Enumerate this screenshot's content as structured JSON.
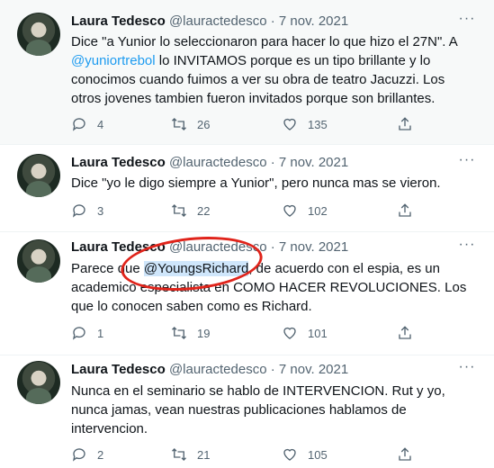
{
  "colors": {
    "accent": "#1d9bf0",
    "muted": "#536471",
    "annotation": "#e0241b"
  },
  "tweets": [
    {
      "name": "Laura Tedesco",
      "handle": "@lauractedesco",
      "separator": "·",
      "date": "7 nov. 2021",
      "text_before": "Dice \"a Yunior lo seleccionaron para hacer lo que hizo el 27N\". A ",
      "mention": "@yuniortrebol",
      "text_after": " lo INVITAMOS porque es un tipo brillante y lo conocimos cuando fuimos a ver su obra de teatro Jacuzzi. Los otros jovenes tambien fueron invitados porque son brillantes.",
      "replies": "4",
      "retweets": "26",
      "likes": "135"
    },
    {
      "name": "Laura Tedesco",
      "handle": "@lauractedesco",
      "separator": "·",
      "date": "7 nov. 2021",
      "text": "Dice \"yo le digo siempre a Yunior\", pero nunca mas se vieron.",
      "replies": "3",
      "retweets": "22",
      "likes": "102"
    },
    {
      "name": "Laura Tedesco",
      "handle": "@lauractedesco",
      "separator": "·",
      "date": "7 nov. 2021",
      "text_before": "Parece que ",
      "mention": "@YoungsRichard",
      "text_after": ", de acuerdo con el espia, es un academico especialista en COMO HACER REVOLUCIONES. Los que lo conocen saben como es Richard.",
      "replies": "1",
      "retweets": "19",
      "likes": "101"
    },
    {
      "name": "Laura Tedesco",
      "handle": "@lauractedesco",
      "separator": "·",
      "date": "7 nov. 2021",
      "text": "Nunca en el seminario se hablo de INTERVENCION. Rut y yo, nunca jamas, vean nuestras publicaciones hablamos de intervencion.",
      "replies": "2",
      "retweets": "21",
      "likes": "105"
    }
  ]
}
